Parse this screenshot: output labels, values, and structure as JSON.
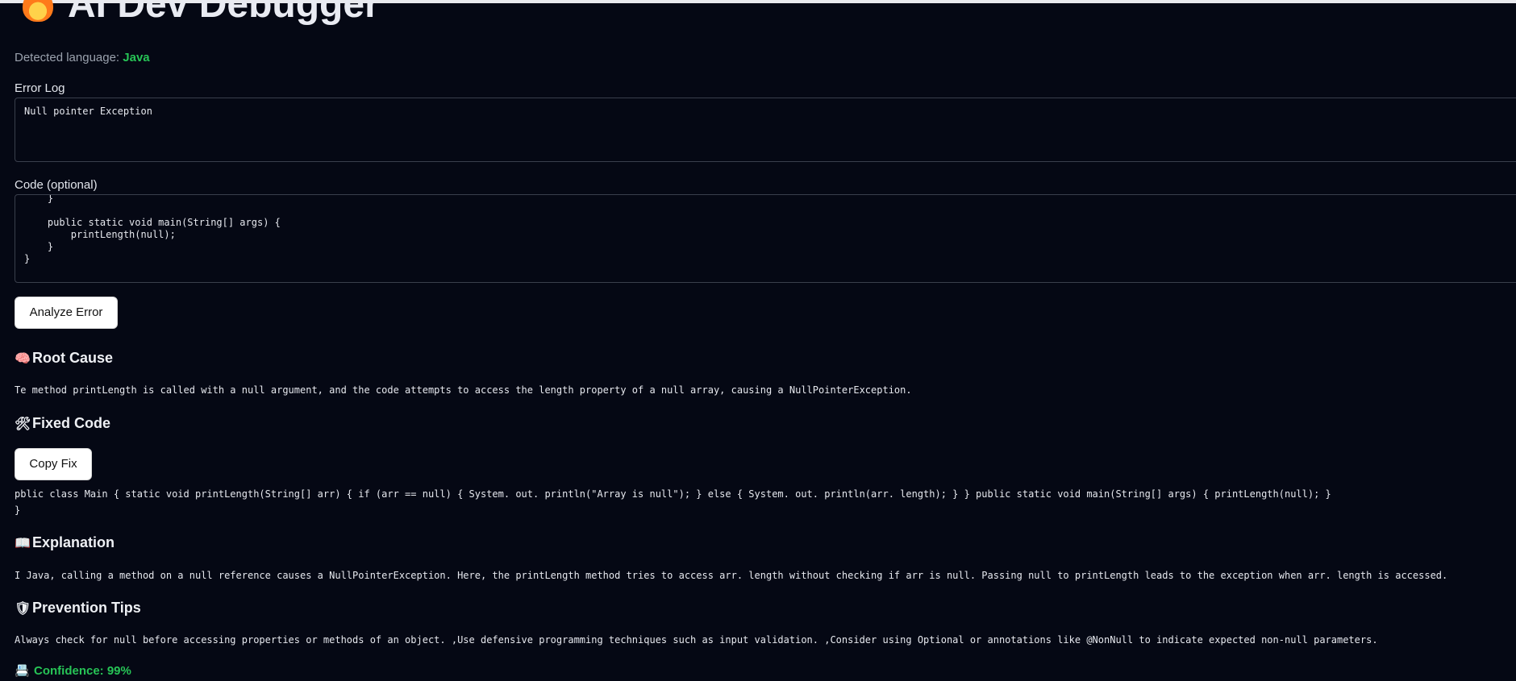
{
  "app": {
    "title": "AI Dev Debugger",
    "title_icon": "flame-icon"
  },
  "language": {
    "label": "Detected language:",
    "value": "Java",
    "value_color": "#27c456"
  },
  "error_log": {
    "label": "Error Log",
    "value": "Null pointer Exception"
  },
  "code": {
    "label": "Code (optional)",
    "value": "    }\n\n    public static void main(String[] args) {\n        printLength(null);\n    }\n}"
  },
  "analyze": {
    "label": "Analyze Error"
  },
  "root_cause": {
    "icon": "🧠",
    "heading": "Root Cause",
    "text": "Te method printLength is called with a null argument, and the code attempts to access the length property of a null array, causing a NullPointerException."
  },
  "fixed_code": {
    "icon": "🛠",
    "heading": "Fixed Code",
    "copy_label": "Copy Fix",
    "text": "pblic class Main { static void printLength(String[] arr) { if (arr == null) { System. out. println(\"Array is null\"); } else { System. out. println(arr. length); } } public static void main(String[] args) { printLength(null); }\n}"
  },
  "explanation": {
    "icon": "📖",
    "heading": "Explanation",
    "text": "I Java, calling a method on a null reference causes a NullPointerException. Here, the printLength method tries to access arr. length without checking if arr is null. Passing null to printLength leads to the exception when arr. length is accessed."
  },
  "prevention": {
    "icon": "🛡",
    "heading": "Prevention Tips",
    "text": "Always check for null before accessing properties or methods of an object. ,Use defensive programming techniques such as input validation. ,Consider using Optional or annotations like @NonNull to indicate expected non-null parameters."
  },
  "confidence": {
    "icon": "📇",
    "text": "Confidence: 99%",
    "color": "#27c456"
  }
}
